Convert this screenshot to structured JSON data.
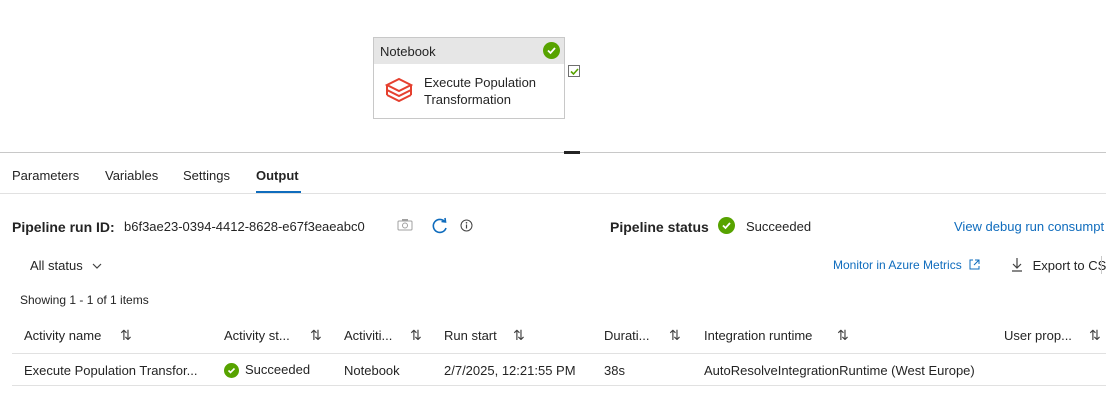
{
  "activity_card": {
    "type_label": "Notebook",
    "title_line1": "Execute Population",
    "title_line2": "Transformation"
  },
  "tabs": [
    {
      "label": "Parameters"
    },
    {
      "label": "Variables"
    },
    {
      "label": "Settings"
    },
    {
      "label": "Output",
      "active": true
    }
  ],
  "run_info": {
    "run_id_label": "Pipeline run ID:",
    "run_id": "b6f3ae23-0394-4412-8628-e67f3eaeabc0",
    "status_label": "Pipeline status",
    "status": "Succeeded",
    "debug_link": "View debug run consumpt"
  },
  "toolbar": {
    "filter": "All status",
    "monitor_link": "Monitor in Azure Metrics",
    "export": "Export to CSV"
  },
  "showing": "Showing 1 - 1 of 1 items",
  "table": {
    "columns": [
      "Activity name",
      "Activity st...",
      "Activiti...",
      "Run start",
      "Durati...",
      "Integration runtime",
      "User prop..."
    ],
    "rows": [
      {
        "activity_name": "Execute Population Transfor...",
        "status": "Succeeded",
        "activity_type": "Notebook",
        "run_start": "2/7/2025, 12:21:55 PM",
        "duration": "38s",
        "integration_runtime": "AutoResolveIntegrationRuntime (West Europe)",
        "user_properties": ""
      }
    ]
  },
  "colors": {
    "accent": "#0f6cbd",
    "success": "#57a300",
    "notebook_icon": "#e5402f"
  }
}
